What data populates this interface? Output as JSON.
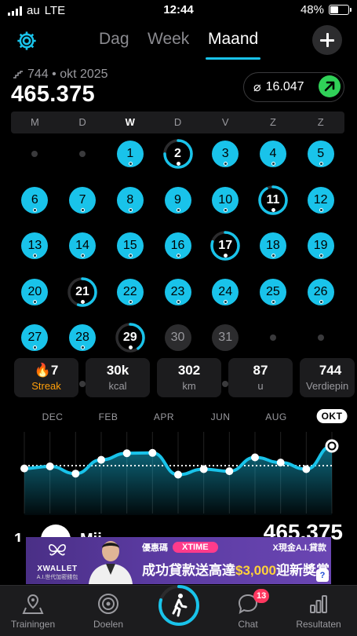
{
  "status_bar": {
    "carrier": "au",
    "network": "LTE",
    "time": "12:44",
    "battery": "48%",
    "battery_level": 0.48
  },
  "header": {
    "tabs": [
      {
        "label": "Dag",
        "active": false
      },
      {
        "label": "Week",
        "active": false
      },
      {
        "label": "Maand",
        "active": true
      }
    ],
    "settings_icon": "gear-icon",
    "add_icon": "plus-icon"
  },
  "summary": {
    "rank_label": "744 • okt 2025",
    "total": "465.375",
    "average": "16.047",
    "average_symbol": "⌀",
    "trend_icon": "arrow-up-right-icon",
    "accent_color": "#19c3ea",
    "trend_color": "#30d158"
  },
  "weekdays": [
    "M",
    "D",
    "W",
    "D",
    "V",
    "Z",
    "Z"
  ],
  "today_weekday_index": 2,
  "calendar": {
    "leading_empty": 2,
    "days": [
      {
        "n": "1",
        "state": "full"
      },
      {
        "n": "2",
        "state": "partial",
        "progress": 0.75
      },
      {
        "n": "3",
        "state": "full"
      },
      {
        "n": "4",
        "state": "full"
      },
      {
        "n": "5",
        "state": "full"
      },
      {
        "n": "6",
        "state": "full"
      },
      {
        "n": "7",
        "state": "full"
      },
      {
        "n": "8",
        "state": "full"
      },
      {
        "n": "9",
        "state": "full"
      },
      {
        "n": "10",
        "state": "full"
      },
      {
        "n": "11",
        "state": "partial",
        "progress": 0.92
      },
      {
        "n": "12",
        "state": "full"
      },
      {
        "n": "13",
        "state": "full"
      },
      {
        "n": "14",
        "state": "full"
      },
      {
        "n": "15",
        "state": "full"
      },
      {
        "n": "16",
        "state": "full"
      },
      {
        "n": "17",
        "state": "partial",
        "progress": 0.8
      },
      {
        "n": "18",
        "state": "full"
      },
      {
        "n": "19",
        "state": "full"
      },
      {
        "n": "20",
        "state": "full"
      },
      {
        "n": "21",
        "state": "partial",
        "progress": 0.55
      },
      {
        "n": "22",
        "state": "full"
      },
      {
        "n": "23",
        "state": "full"
      },
      {
        "n": "24",
        "state": "full"
      },
      {
        "n": "25",
        "state": "full"
      },
      {
        "n": "26",
        "state": "full"
      },
      {
        "n": "27",
        "state": "full"
      },
      {
        "n": "28",
        "state": "full"
      },
      {
        "n": "29",
        "state": "partial",
        "progress": 0.4
      },
      {
        "n": "30",
        "state": "future"
      },
      {
        "n": "31",
        "state": "future"
      }
    ],
    "trailing_empty": 9
  },
  "stats": [
    {
      "value": "7",
      "label": "Streak",
      "icon": "flame-icon"
    },
    {
      "value": "30k",
      "label": "kcal"
    },
    {
      "value": "302",
      "label": "km"
    },
    {
      "value": "87",
      "label": "u"
    },
    {
      "value": "744",
      "label": "Verdiepin"
    }
  ],
  "trend": {
    "months": [
      {
        "label": "DEC",
        "active": false
      },
      {
        "label": "FEB",
        "active": false
      },
      {
        "label": "APR",
        "active": false
      },
      {
        "label": "JUN",
        "active": false
      },
      {
        "label": "AUG",
        "active": false
      },
      {
        "label": "OKT",
        "active": true
      }
    ]
  },
  "chart_data": {
    "type": "area",
    "series": [
      {
        "values": [
          0.35,
          0.41,
          0.2,
          0.6,
          0.79,
          0.8,
          0.17,
          0.33,
          0.27,
          0.67,
          0.52,
          0.33,
          1.0
        ]
      }
    ],
    "average_line": 0.43,
    "note": "relative monthly values, no y-axis labels shown"
  },
  "leaderboard_row": {
    "rank": "1",
    "name": "Mij",
    "value": "465.375"
  },
  "ad": {
    "brand": "XWALLET",
    "brand_tag": "A.I.世代加密錢包",
    "code_label": "優惠碼",
    "code": "XTIME",
    "headline": "X現金A.I.貸款",
    "main_text": "成功貸款送高達",
    "main_amount": "$3,000",
    "main_suffix": "迎新獎賞",
    "help": "?"
  },
  "tabbar": {
    "items": [
      {
        "label": "Trainingen",
        "icon": "map-pin-icon"
      },
      {
        "label": "Doelen",
        "icon": "target-icon"
      },
      {
        "label": "",
        "icon": "walking-person-icon"
      },
      {
        "label": "Chat",
        "icon": "chat-bubble-icon",
        "badge": "13"
      },
      {
        "label": "Resultaten",
        "icon": "bar-chart-icon"
      }
    ]
  }
}
